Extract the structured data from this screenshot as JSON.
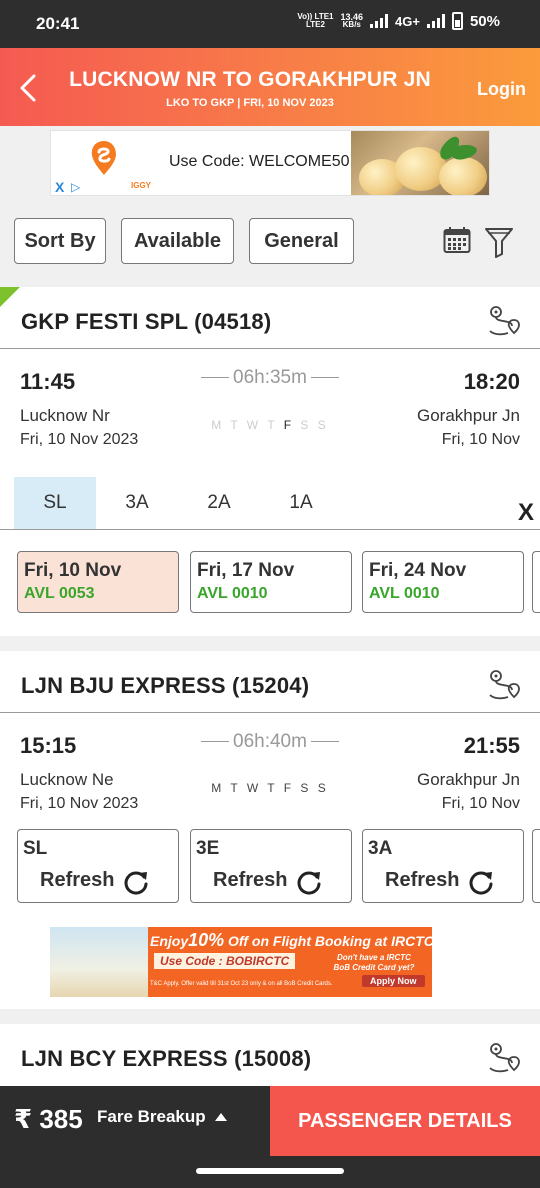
{
  "status_bar": {
    "time": "20:41",
    "volte": "Vo)) LTE1",
    "volte2": "LTE2",
    "speed": "13.46",
    "speed_unit": "KB/s",
    "network": "4G+",
    "battery": "50%"
  },
  "header": {
    "title": "LUCKNOW NR TO GORAKHPUR JN",
    "subtitle": "LKO TO GKP | FRI, 10 NOV  2023",
    "login": "Login"
  },
  "top_ad": {
    "brand": "IGGY",
    "text": "Use Code: WELCOME50",
    "close": "X"
  },
  "filters": {
    "sort_by": "Sort By",
    "available": "Available",
    "general": "General"
  },
  "trains": [
    {
      "name": "GKP FESTI SPL (04518)",
      "dep_time": "11:45",
      "arr_time": "18:20",
      "duration": "06h:35m",
      "from_station": "Lucknow Nr",
      "to_station": "Gorakhpur Jn",
      "dep_date": "Fri, 10 Nov  2023",
      "arr_date": "Fri, 10 Nov",
      "days": "M T W T F S S",
      "classes": [
        "SL",
        "3A",
        "2A",
        "1A"
      ],
      "active_class": "SL",
      "close": "X",
      "availability": [
        {
          "date": "Fri, 10 Nov",
          "status": "AVL 0053",
          "selected": true
        },
        {
          "date": "Fri, 17 Nov",
          "status": "AVL 0010",
          "selected": false
        },
        {
          "date": "Fri, 24 Nov",
          "status": "AVL 0010",
          "selected": false
        }
      ]
    },
    {
      "name": "LJN BJU EXPRESS (15204)",
      "dep_time": "15:15",
      "arr_time": "21:55",
      "duration": "06h:40m",
      "from_station": "Lucknow Ne",
      "to_station": "Gorakhpur Jn",
      "dep_date": "Fri, 10 Nov  2023",
      "arr_date": "Fri, 10 Nov",
      "days": "M T W T F S S",
      "class_boxes": [
        {
          "class": "SL",
          "action": "Refresh"
        },
        {
          "class": "3E",
          "action": "Refresh"
        },
        {
          "class": "3A",
          "action": "Refresh"
        }
      ]
    },
    {
      "name": "LJN BCY EXPRESS (15008)"
    }
  ],
  "irctc_ad": {
    "title_pre": "Enjoy",
    "title_pct": "10%",
    "title_post": "Off on Flight Booking at IRCTC*",
    "code": "Use Code : BOBIRCTC",
    "question": "Don't have a IRCTC BoB Credit Card yet?",
    "apply": "Apply Now",
    "tc": "T&C Apply. Offer valid till 31st Oct 23 only & on all BoB Credit Cards."
  },
  "bottom_bar": {
    "fare": "₹ 385",
    "fare_breakup": "Fare Breakup",
    "cta": "PASSENGER DETAILS"
  },
  "colors": {
    "header_start": "#f55a52",
    "header_end": "#fb9b3c",
    "cta": "#f4564e",
    "available_green": "#3aa52b",
    "selected_date_bg": "#fbe2d6",
    "active_class_bg": "#d7ecf7"
  }
}
